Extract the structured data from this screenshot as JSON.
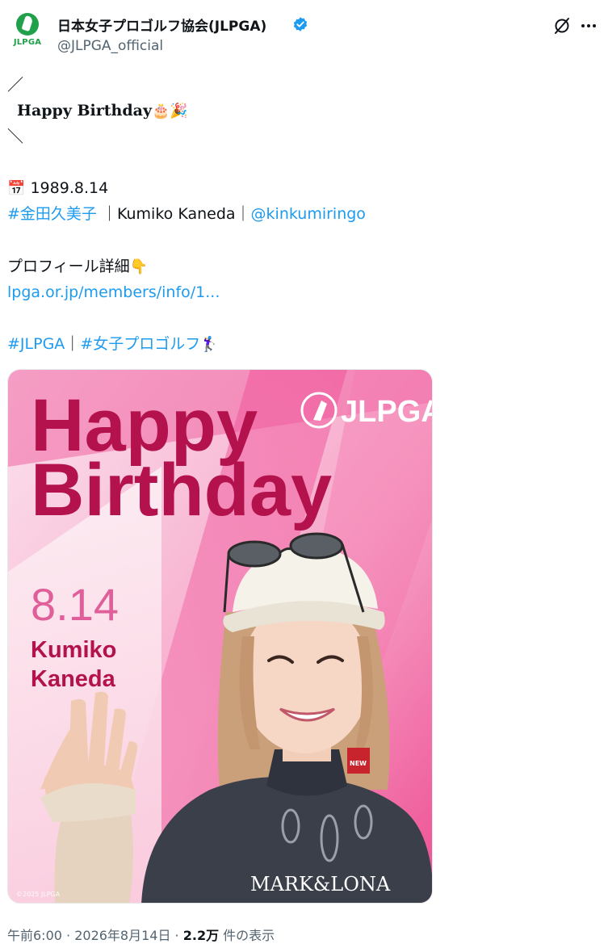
{
  "account": {
    "display_name": "日本女子プロゴルフ協会(JLPGA)",
    "handle": "@JLPGA_official",
    "avatar_text": "JLPGA"
  },
  "post": {
    "bracket_open": "／",
    "title": "Happy Birthday",
    "title_emojis": "🎂🎉",
    "bracket_close": "＼",
    "calendar_emoji": "📅",
    "date": "1989.8.14",
    "hashtag_name": "#金田久美子",
    "name_sep_1": "｜",
    "name_en": "Kumiko Kaneda",
    "name_sep_2": "｜",
    "mention": "@kinkumiringo",
    "profile_label": "プロフィール詳細",
    "profile_emoji": "👇",
    "link": "lpga.or.jp/members/info/1...",
    "hashtag_1": "#JLPGA",
    "tag_sep": "｜",
    "hashtag_2": "#女子プロゴルフ",
    "golfer_emoji": "🏌️‍♀️"
  },
  "card": {
    "headline_1": "Happy",
    "headline_2": "Birthday",
    "logo": "JLPGA",
    "date": "8.14",
    "name_1": "Kumiko",
    "name_2": "Kaneda",
    "shirt_text": "MARK&LONA",
    "collar_text": "NEW",
    "copyright": "©2025 JLPGA"
  },
  "footer": {
    "time": "午前6:00",
    "sep_1": " · ",
    "date": "2026年8月14日",
    "sep_2": " · ",
    "views_count": "2.2万",
    "views_label": " 件の表示"
  },
  "colors": {
    "accent_link": "#1d9bf0",
    "verified": "#1d9bf0",
    "card_title": "#b3124d",
    "card_pink": "#f05a99",
    "brand_green": "#20a04a"
  },
  "icons": {
    "verified": "verified-badge-icon",
    "grok": "grok-icon",
    "more": "more-dots-icon",
    "logo": "jlpga-logo-icon"
  }
}
